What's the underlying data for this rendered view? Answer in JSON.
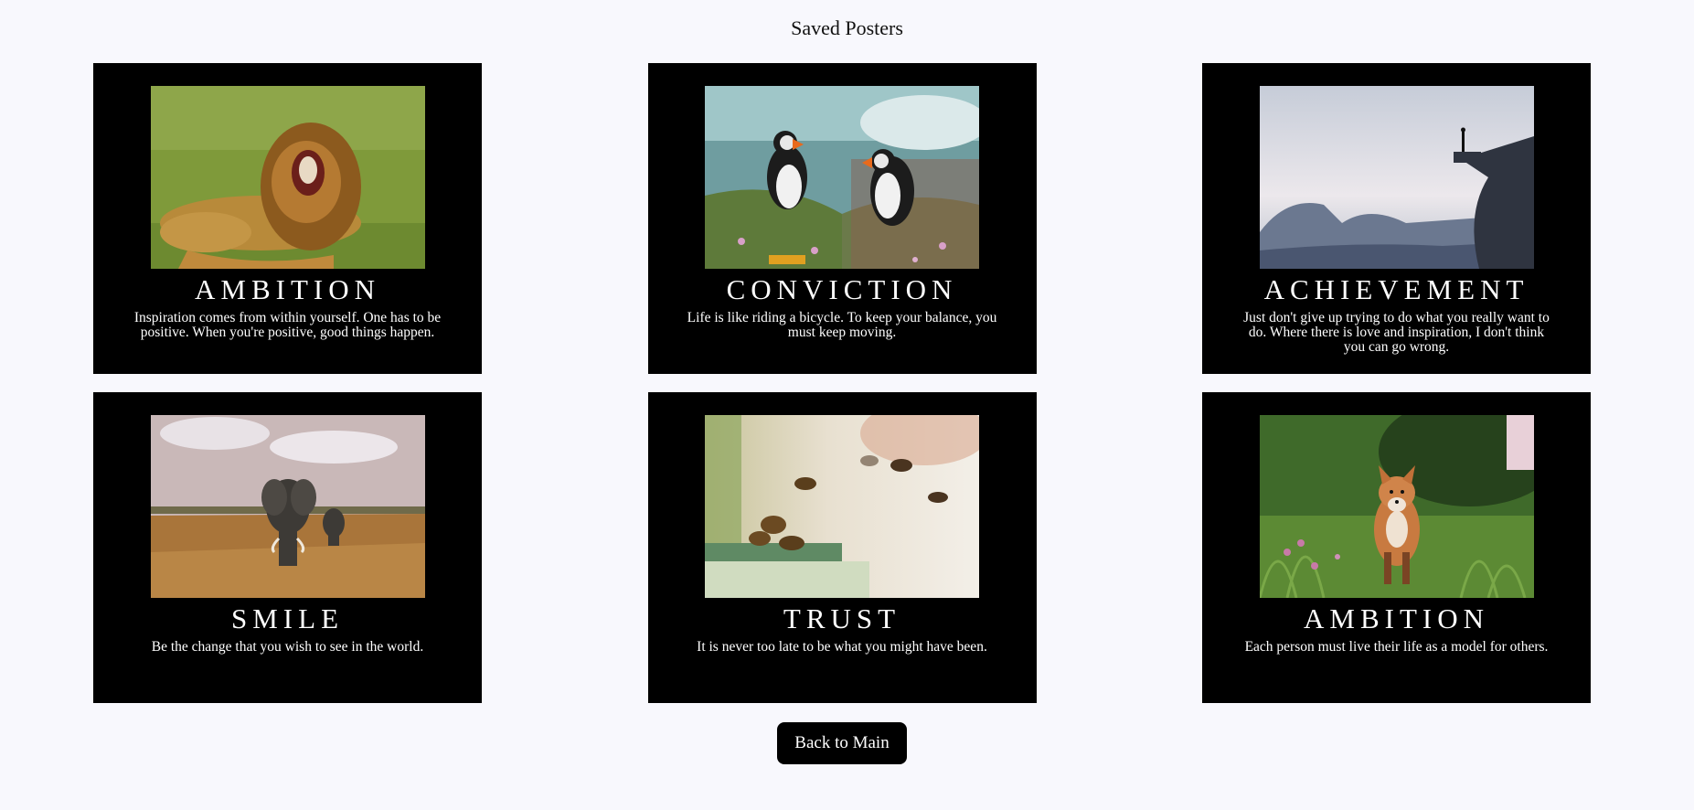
{
  "page": {
    "title": "Saved Posters"
  },
  "posters": [
    {
      "title": "Ambition",
      "quote": "Inspiration comes from within yourself. One has to be positive. When you're positive, good things happen.",
      "image_icon": "lion-photo-icon"
    },
    {
      "title": "Conviction",
      "quote": "Life is like riding a bicycle. To keep your balance, you must keep moving.",
      "image_icon": "puffins-photo-icon"
    },
    {
      "title": "Achievement",
      "quote": "Just don't give up trying to do what you really want to do. Where there is love and inspiration, I don't think you can go wrong.",
      "image_icon": "cliff-photo-icon"
    },
    {
      "title": "Smile",
      "quote": "Be the change that you wish to see in the world.",
      "image_icon": "elephants-photo-icon"
    },
    {
      "title": "Trust",
      "quote": "It is never too late to be what you might have been.",
      "image_icon": "bees-photo-icon"
    },
    {
      "title": "Ambition",
      "quote": "Each person must live their life as a model for others.",
      "image_icon": "fox-photo-icon"
    }
  ],
  "actions": {
    "back_label": "Back to Main"
  },
  "colors": {
    "background": "#f8f8fd",
    "poster_background": "#000000",
    "text_on_poster": "#ffffff",
    "button_background": "#000000"
  }
}
